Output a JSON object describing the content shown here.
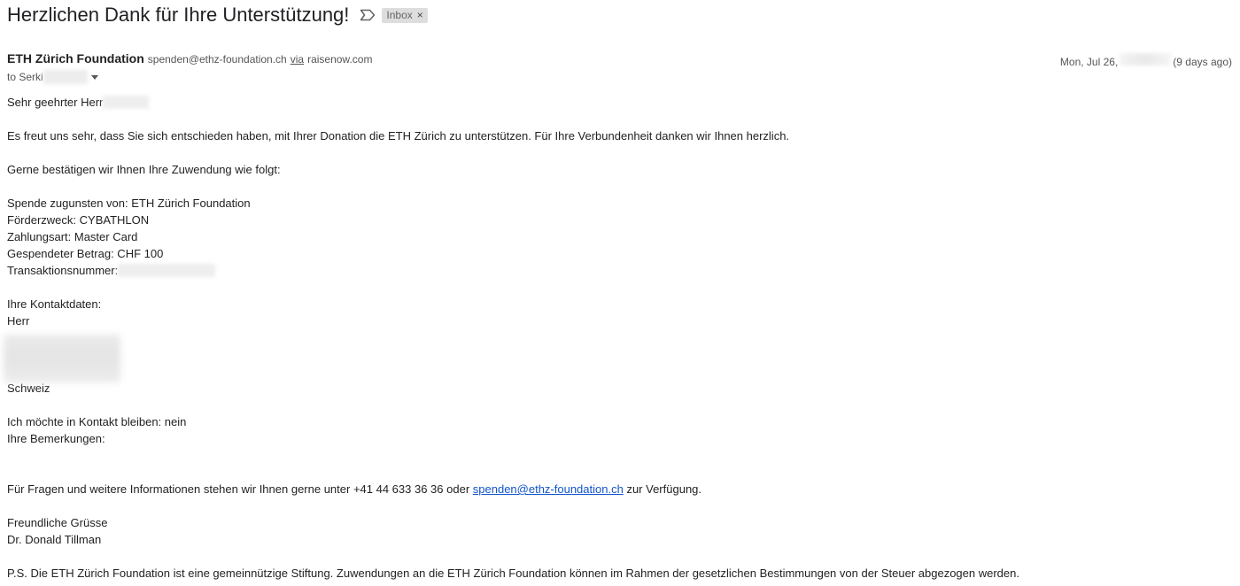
{
  "subject": "Herzlichen Dank für Ihre Unterstützung!",
  "label": {
    "text": "Inbox",
    "close": "×"
  },
  "sender": {
    "name": "ETH Zürich Foundation",
    "email": "spenden@ethz-foundation.ch",
    "via_label": "via",
    "via_domain": "raisenow.com"
  },
  "date": {
    "prefix": "Mon, Jul 26,",
    "relative": "(9 days ago)"
  },
  "recipient": {
    "prefix": "to Serki"
  },
  "body": {
    "greeting": "Sehr geehrter Herr",
    "p1": "Es freut uns sehr, dass Sie sich entschieden haben, mit Ihrer Donation die ETH Zürich zu unterstützen. Für Ihre Verbundenheit danken wir Ihnen herzlich.",
    "p2": "Gerne bestätigen wir Ihnen Ihre Zuwendung wie folgt:",
    "donation": {
      "recipient": "Spende zugunsten von: ETH Zürich Foundation",
      "purpose": "Förderzweck: CYBATHLON",
      "payment": "Zahlungsart: Master Card",
      "amount": "Gespendeter Betrag: CHF 100",
      "transaction": "Transaktionsnummer:"
    },
    "contact_heading": "Ihre Kontaktdaten:",
    "salutation": "Herr",
    "country": "Schweiz",
    "stay_in_contact": "Ich möchte in Kontakt bleiben: nein",
    "remarks": "Ihre Bemerkungen:",
    "questions_pre": "Für Fragen und weitere Informationen stehen wir Ihnen gerne unter +41 44 633 36 36 oder",
    "questions_link": "spenden@ethz-foundation.ch",
    "questions_post": "zur Verfügung.",
    "closing": "Freundliche Grüsse",
    "signature": "Dr. Donald Tillman",
    "ps": "P.S. Die ETH Zürich Foundation ist eine gemeinnützige Stiftung. Zuwendungen an die ETH Zürich Foundation können im Rahmen der gesetzlichen Bestimmungen von der Steuer abgezogen werden."
  },
  "colors": {
    "link": "#1155cc",
    "chip_bg": "#dddddd",
    "muted_text": "#555555"
  },
  "icons": {
    "important": "important-marker-icon",
    "caret": "chevron-down-icon"
  }
}
